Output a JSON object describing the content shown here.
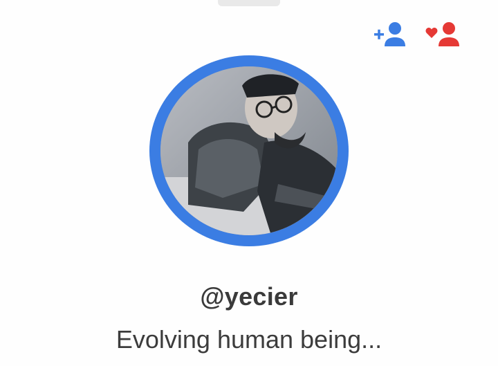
{
  "profile": {
    "username": "@yecier",
    "bio": "Evolving human being..."
  },
  "actions": {
    "follow_icon": "person-add-icon",
    "favorite_icon": "heart-person-icon"
  },
  "colors": {
    "accent_blue": "#3b7de3",
    "favorite_red": "#e53935",
    "text_dark": "#3a3a3a"
  }
}
